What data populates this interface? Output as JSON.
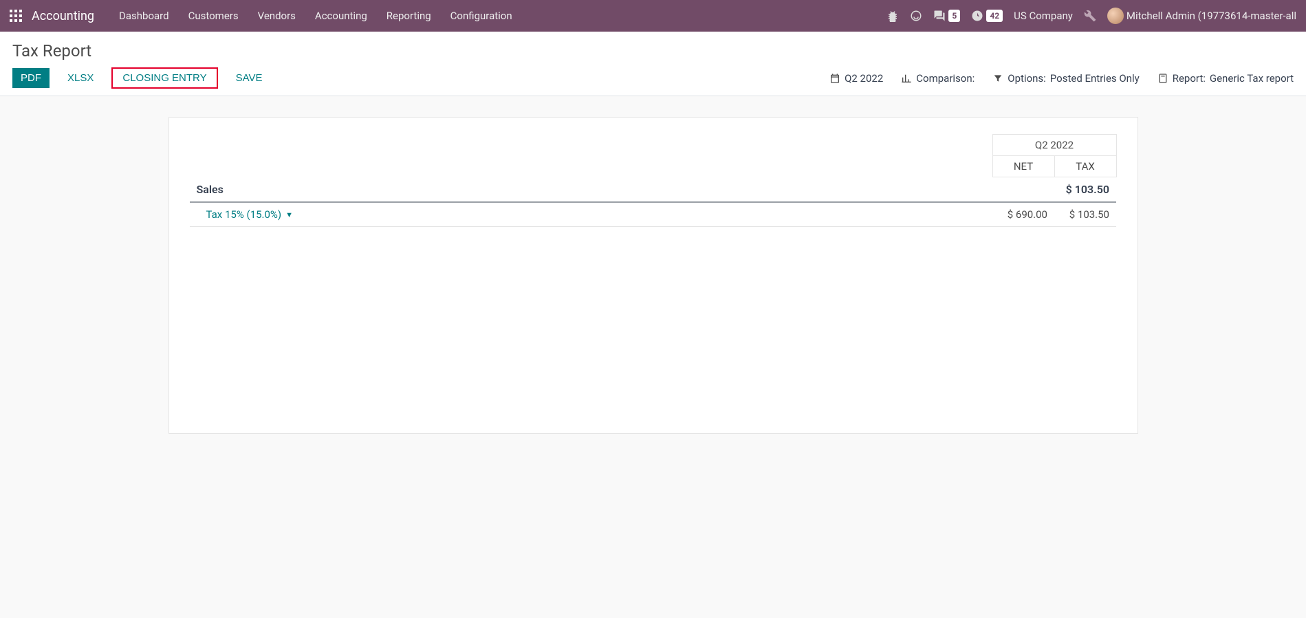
{
  "navbar": {
    "brand": "Accounting",
    "items": [
      "Dashboard",
      "Customers",
      "Vendors",
      "Accounting",
      "Reporting",
      "Configuration"
    ],
    "messages_badge": "5",
    "activities_badge": "42",
    "company": "US Company",
    "user": "Mitchell Admin (19773614-master-all"
  },
  "control_panel": {
    "title": "Tax Report",
    "buttons": {
      "pdf": "PDF",
      "xlsx": "XLSX",
      "closing_entry": "CLOSING ENTRY",
      "save": "SAVE"
    },
    "period": "Q2 2022",
    "comparison_label": "Comparison:",
    "options_label": "Options:",
    "options_value": "Posted Entries Only",
    "report_label": "Report: ",
    "report_value": "Generic Tax report"
  },
  "report": {
    "period_header": "Q2 2022",
    "col_net": "NET",
    "col_tax": "TAX",
    "group": {
      "name": "Sales",
      "tax_total": "$ 103.50"
    },
    "lines": [
      {
        "name": "Tax 15% (15.0%)",
        "net": "$ 690.00",
        "tax": "$ 103.50"
      }
    ]
  }
}
